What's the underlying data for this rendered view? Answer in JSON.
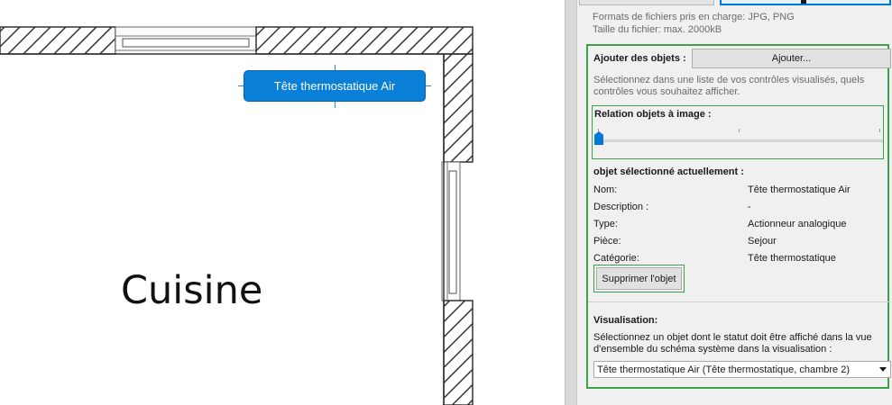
{
  "canvas": {
    "room_label": "Cuisine",
    "device_label": "Tête thermostatique Air"
  },
  "panel": {
    "formats_line1": "Formats de fichiers pris en charge: JPG, PNG",
    "formats_line2": "Taille du fichier: max. 2000kB",
    "add_objects_label": "Ajouter des objets :",
    "add_button_label": "Ajouter...",
    "add_description_line1": "Sélectionnez dans une liste de vos contrôles visualisés, quels",
    "add_description_line2": "contrôles vous souhaitez afficher.",
    "relation_label": "Relation objets à image :",
    "slider_value": 0,
    "selected_title": "objet sélectionné actuellement :",
    "properties": [
      {
        "key": "Nom:",
        "value": "Tête thermostatique Air"
      },
      {
        "key": "Description :",
        "value": "-"
      },
      {
        "key": "Type:",
        "value": "Actionneur analogique"
      },
      {
        "key": "Pièce:",
        "value": "Sejour"
      },
      {
        "key": "Catégorie:",
        "value": "Tête thermostatique"
      }
    ],
    "delete_button_label": "Supprimer l'objet",
    "visualisation_title": "Visualisation:",
    "visualisation_desc_line1": "Sélectionnez un objet dont le statut doit être affiché dans la vue",
    "visualisation_desc_line2": "d'ensemble du schéma système dans la visualisation :",
    "visualisation_selected": "Tête thermostatique Air (Tête thermostatique, chambre 2)"
  },
  "colors": {
    "accent": "#0078d7",
    "device_box": "#0a7fd8",
    "highlight_border": "#3aa24a"
  }
}
